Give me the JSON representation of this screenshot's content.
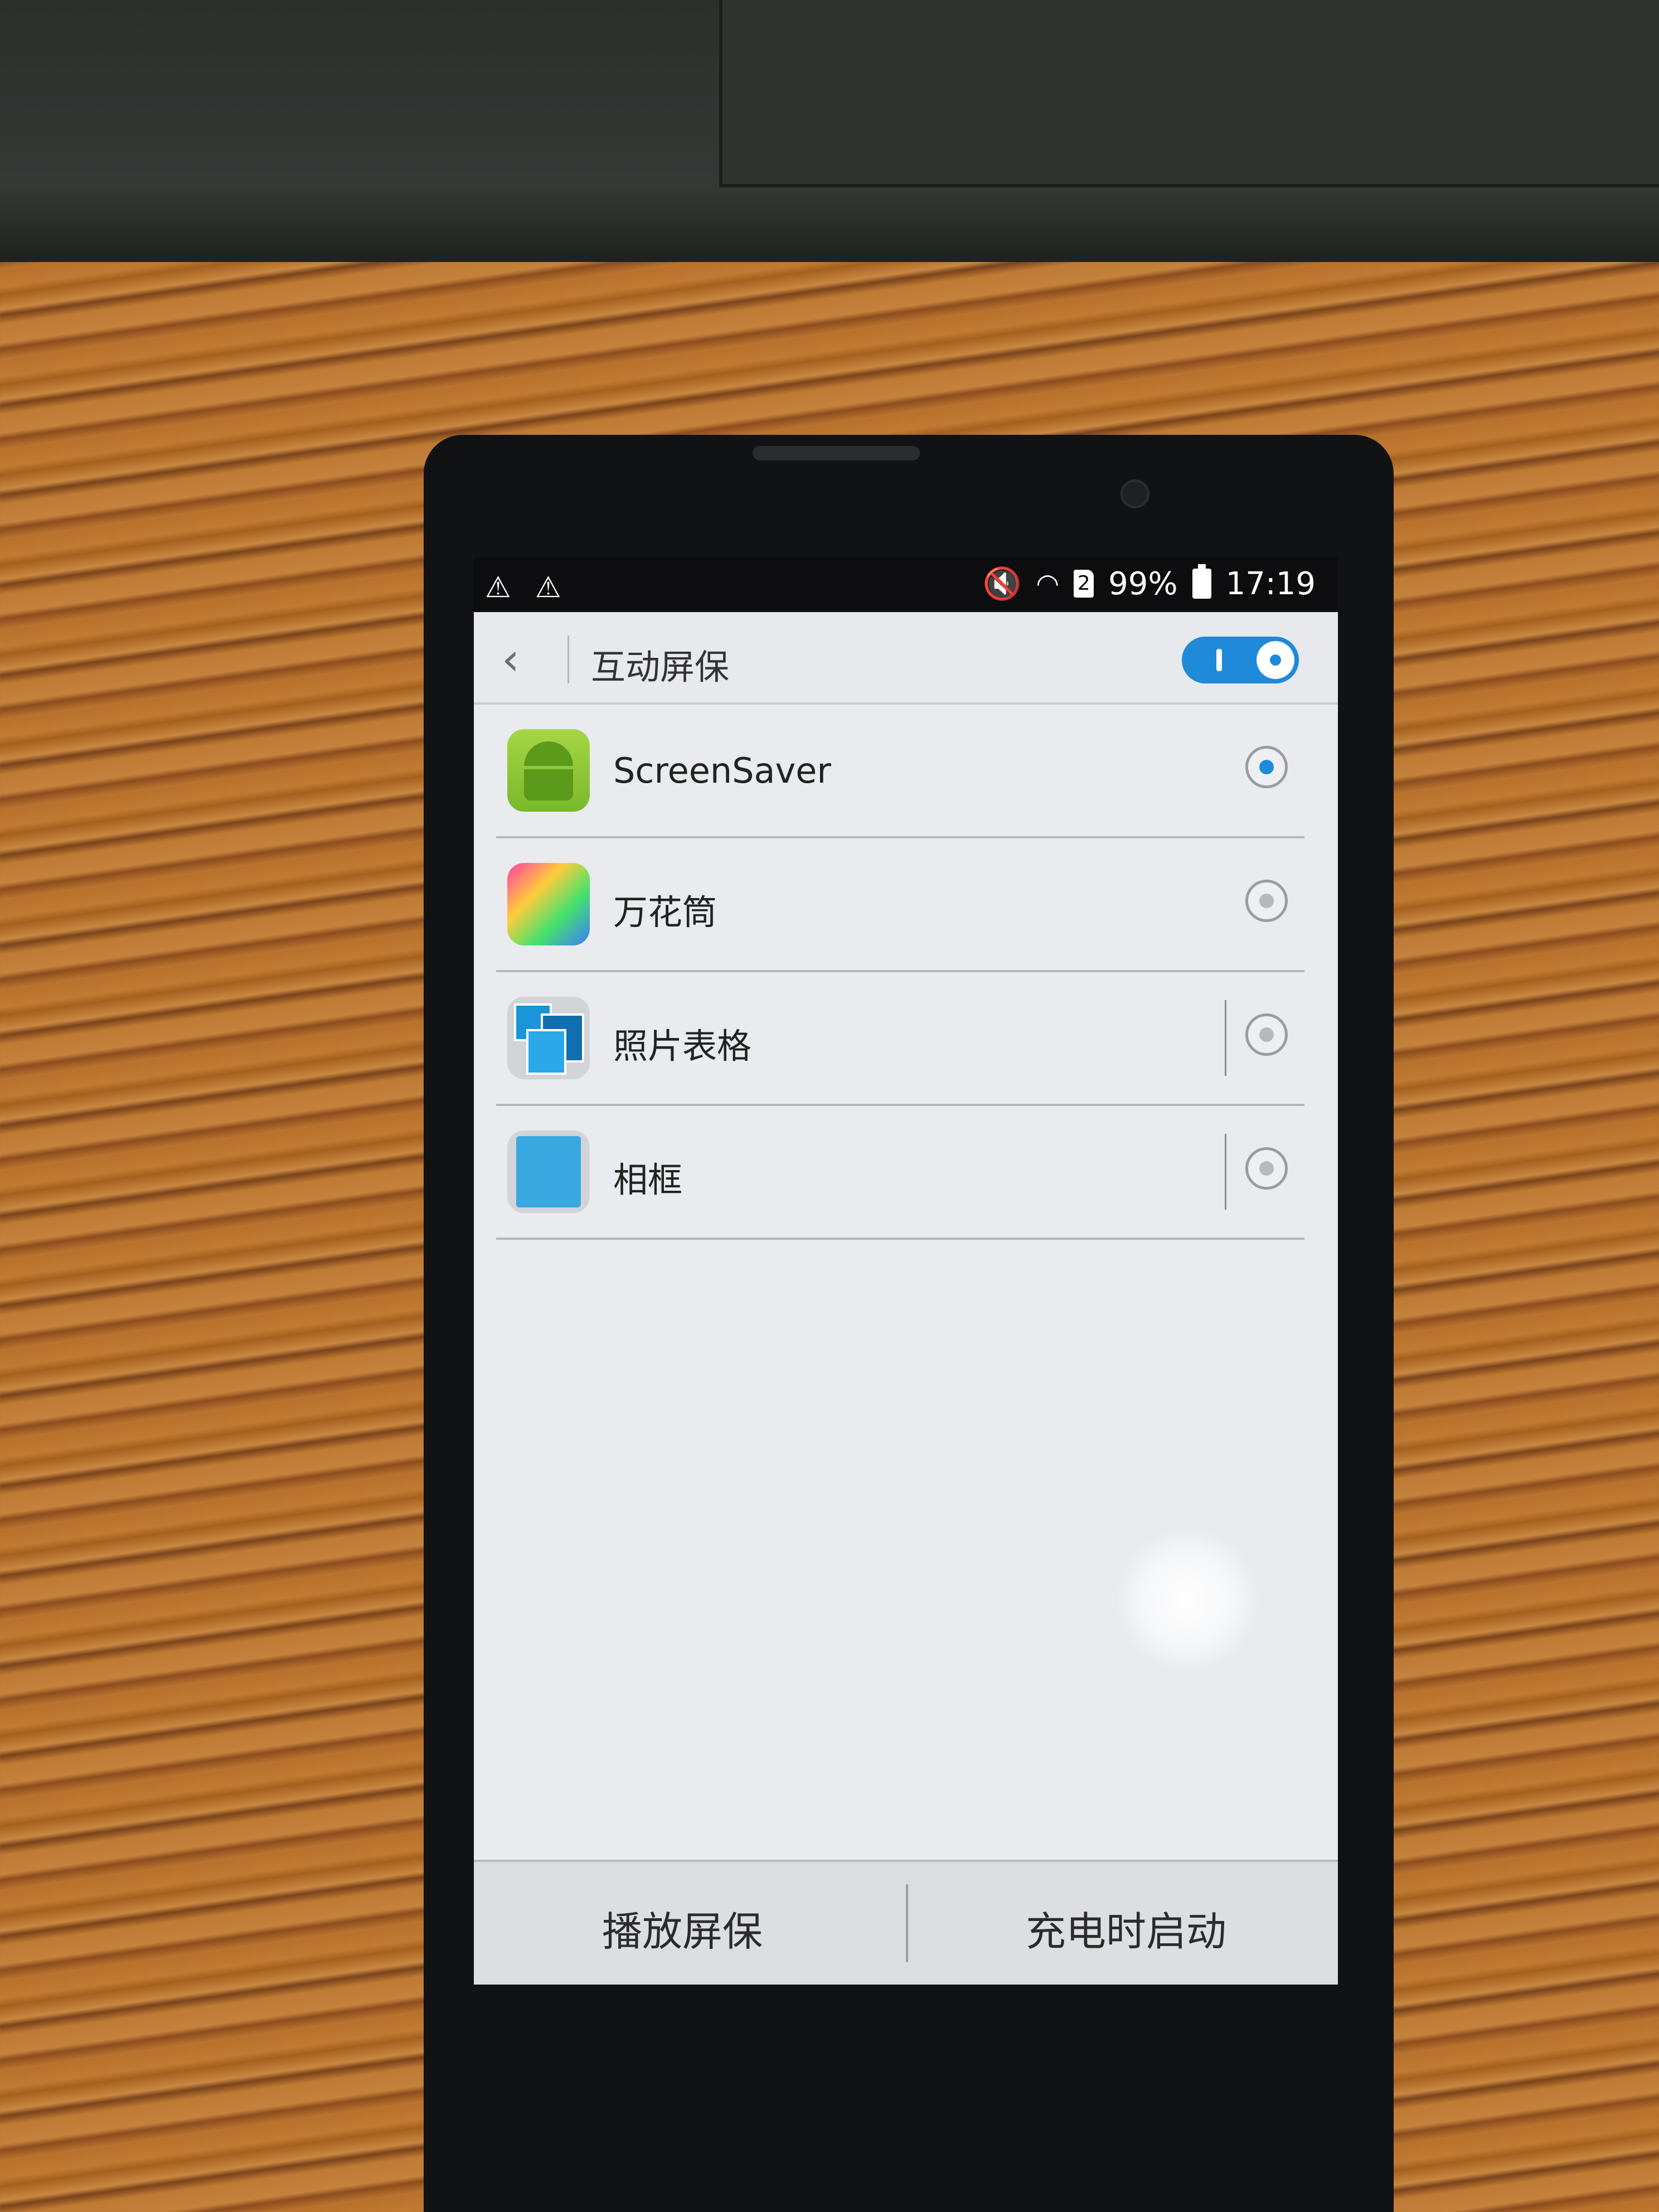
{
  "status_bar": {
    "battery_percent": "99%",
    "time": "17:19",
    "sim_label": "2"
  },
  "header": {
    "title": "互动屏保",
    "toggle_on": true
  },
  "screensavers": [
    {
      "label": "ScreenSaver",
      "selected": true
    },
    {
      "label": "万花筒",
      "selected": false
    },
    {
      "label": "照片表格",
      "selected": false
    },
    {
      "label": "相框",
      "selected": false
    }
  ],
  "bottom_bar": {
    "play_label": "播放屏保",
    "charge_label": "充电时启动"
  },
  "colors": {
    "accent": "#1e8ad9"
  }
}
